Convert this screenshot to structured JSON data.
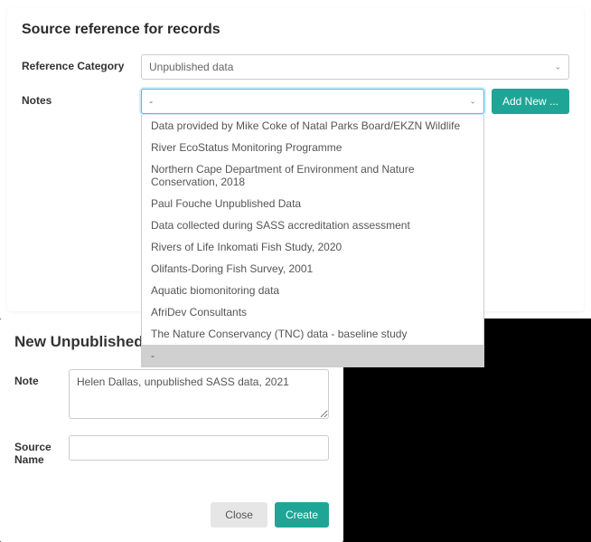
{
  "panel": {
    "title": "Source reference for records",
    "category_label": "Reference Category",
    "category_value": "Unpublished data",
    "notes_label": "Notes",
    "notes_value": "-",
    "add_new_label": "Add New ...",
    "dropdown_items": [
      "Data provided by Mike Coke of Natal Parks Board/EKZN Wildlife",
      "River EcoStatus Monitoring Programme",
      "Northern Cape Department of Environment and Nature Conservation, 2018",
      "Paul Fouche Unpublished Data",
      "Data collected during SASS accreditation assessment",
      "Rivers of Life Inkomati Fish Study, 2020",
      "Olifants-Doring Fish Survey, 2001",
      "Aquatic biomonitoring data",
      "AfriDev Consultants",
      "The Nature Conservancy (TNC) data - baseline study",
      "-"
    ]
  },
  "modal": {
    "title": "New Unpublished Data",
    "note_label": "Note",
    "note_value": "Helen Dallas, unpublished SASS data, 2021",
    "source_label": "Source Name",
    "source_value": "",
    "close_label": "Close",
    "create_label": "Create"
  }
}
